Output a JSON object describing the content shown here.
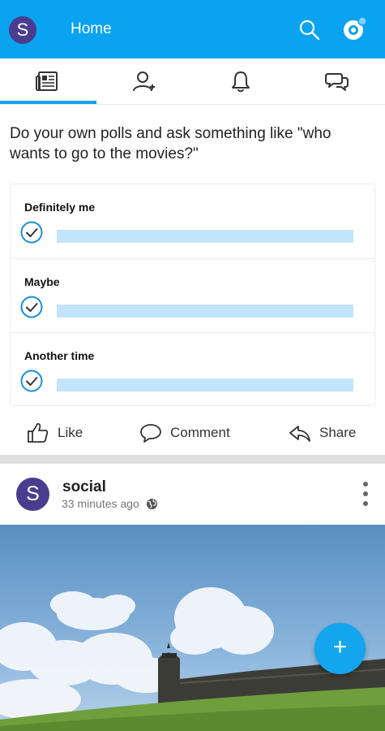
{
  "header": {
    "avatar_letter": "S",
    "title": "Home",
    "search_icon": "search-icon",
    "notifications_icon": "notification-badge-icon",
    "accent_color": "#0aa3f0"
  },
  "tabs": [
    {
      "name": "newsfeed",
      "icon": "newspaper-icon",
      "active": true
    },
    {
      "name": "friends",
      "icon": "add-person-icon",
      "active": false
    },
    {
      "name": "notifications",
      "icon": "bell-icon",
      "active": false
    },
    {
      "name": "messages",
      "icon": "chat-bubbles-icon",
      "active": false
    }
  ],
  "post1": {
    "text": "Do your own polls and ask something like \"who wants to go to the movies?\"",
    "poll": {
      "options": [
        {
          "label": "Definitely me",
          "fraction": 1.0
        },
        {
          "label": "Maybe",
          "fraction": 1.0
        },
        {
          "label": "Another time",
          "fraction": 1.0
        }
      ]
    },
    "actions": {
      "like": "Like",
      "comment": "Comment",
      "share": "Share"
    }
  },
  "post2": {
    "avatar_letter": "S",
    "author": "social",
    "time": "33 minutes ago",
    "privacy_icon": "globe-icon",
    "more_icon": "more-vertical-icon"
  },
  "fab": {
    "label": "+",
    "icon": "plus-icon"
  }
}
